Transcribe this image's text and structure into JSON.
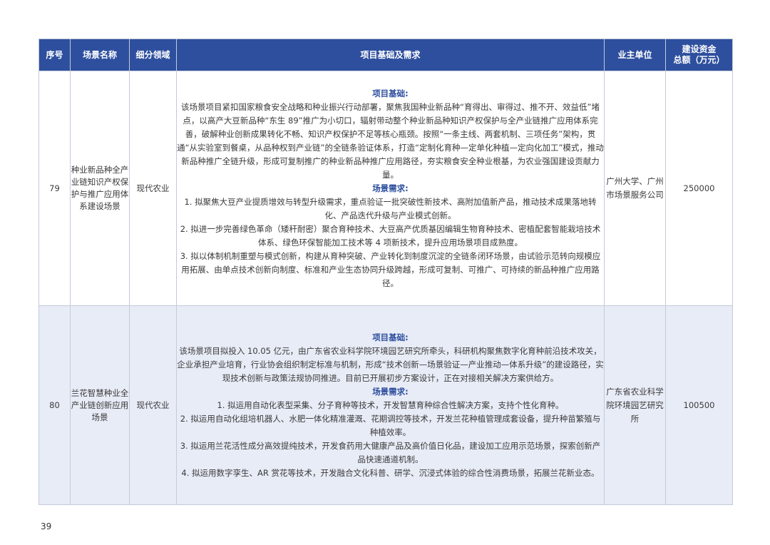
{
  "columns": {
    "no": "序号",
    "name": "场景名称",
    "field": "细分领域",
    "detail": "项目基础及需求",
    "owner": "业主单位",
    "investment_l1": "建设资金",
    "investment_l2": "总额（万元）"
  },
  "rows": [
    {
      "no": "79",
      "name": "种业新品种全产业链知识产权保护与推广应用体系建设场景",
      "field": "现代农业",
      "basis_heading": "项目基础:",
      "basis_text": "该场景项目紧扣国家粮食安全战略和种业振兴行动部署，聚焦我国种业新品种“育得出、审得过、推不开、效益低”堵点，以高产大豆新品种“东生 89”推广为小切口，辐射带动整个种业新品种知识产权保护与全产业链推广应用体系完善，破解种业创新成果转化不畅、知识产权保护不足等核心瓶颈。按照“一条主线、两套机制、三项任务”架构，贯通“从实验室到餐桌，从品种权到产业链”的全链条验证体系，打造“定制化育种—定单化种植—定向化加工”模式，推动新品种推广全链升级，形成可复制推广的种业新品种推广应用路径，夯实粮食安全种业根基，为农业强国建设贡献力量。",
      "needs_heading": "场景需求:",
      "needs": [
        "1. 拟聚焦大豆产业提质增效与转型升级需求，重点验证一批突破性新技术、高附加值新产品，推动技术成果落地转化、产品迭代升级与产业模式创新。",
        "2. 拟进一步完善绿色革命（矮秆耐密）聚合育种技术、大豆高产优质基因编辑生物育种技术、密植配套智能栽培技术体系、绿色环保智能加工技术等 4 项新技术，提升应用场景项目成熟度。",
        "3. 拟以体制机制重塑与模式创新，构建从育种突破、产业转化到制度沉淀的全链条闭环场景，由试验示范转向规模应用拓展、由单点技术创新向制度、标准和产业生态协同升级跨越，形成可复制、可推广、可持续的新品种推广应用路径。"
      ],
      "owner": "广州大学、广州市场景服务公司",
      "investment": "250000"
    },
    {
      "no": "80",
      "name": "兰花智慧种业全产业链创新应用场景",
      "field": "现代农业",
      "basis_heading": "项目基础:",
      "basis_text": "该场景项目拟投入 10.05 亿元，由广东省农业科学院环境园艺研究所牵头，科研机构聚焦数字化育种前沿技术攻关，企业承担产业培育，行业协会组织制定标准与机制，形成“技术创新—场景验证—产业推动—体系升级”的建设路径，实现技术创新与政策法规协同推进。目前已开展初步方案设计，正在对接相关解决方案供给方。",
      "needs_heading": "场景需求:",
      "needs": [
        "1. 拟运用自动化表型采集、分子育种等技术，开发智慧育种综合性解决方案，支持个性化育种。",
        "2. 拟运用自动化组培机器人、水肥一体化精准灌溉、花期调控等技术，开发兰花种植管理成套设备，提升种苗繁殖与种植效率。",
        "3. 拟运用兰花活性成分高效提纯技术，开发食药用大健康产品及高价值日化品，建设加工应用示范场景，探索创新产品快速通道机制。",
        "4. 拟运用数字孪生、AR 赏花等技术，开发融合文化科普、研学、沉浸式体验的综合性消费场景，拓展兰花新业态。"
      ],
      "owner": "广东省农业科学院环境园艺研究所",
      "investment": "100500"
    }
  ],
  "page_number": "39",
  "colors": {
    "header_bg": "#2e4f9e",
    "header_text": "#ffffff",
    "heading_text": "#2e4f9e",
    "alt_row_bg": "#e8ecf7",
    "border": "#c3cad8"
  }
}
